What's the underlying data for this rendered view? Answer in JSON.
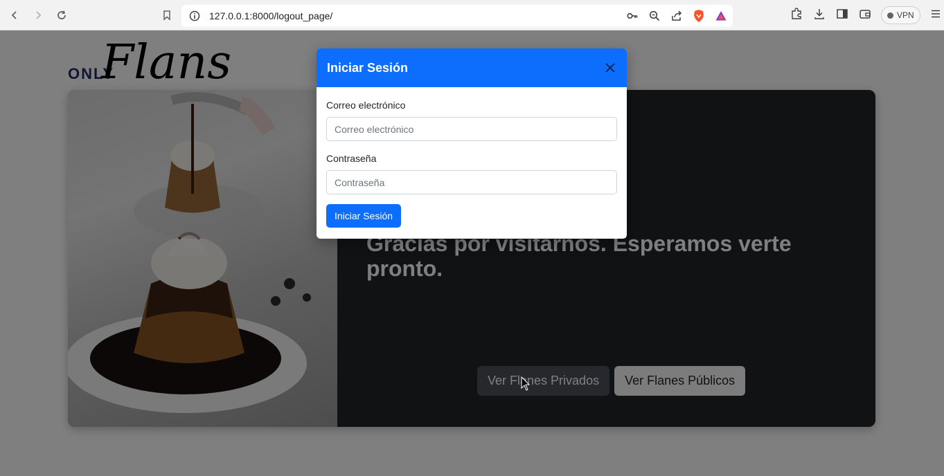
{
  "browser": {
    "url": "127.0.0.1:8000/logout_page/",
    "vpn_label": "VPN"
  },
  "logo": {
    "prefix": "ONLY",
    "name": "Flans"
  },
  "hero": {
    "message": "Gracias por visitarnos. Esperamos verte pronto.",
    "private_button": "Ver Flanes Privados",
    "public_button": "Ver Flanes Públicos"
  },
  "modal": {
    "title": "Iniciar Sesión",
    "email_label": "Correo electrónico",
    "email_placeholder": "Correo electrónico",
    "password_label": "Contraseña",
    "password_placeholder": "Contraseña",
    "submit_label": "Iniciar Sesión"
  },
  "colors": {
    "primary": "#0d6efd",
    "card_dark": "#212529"
  }
}
